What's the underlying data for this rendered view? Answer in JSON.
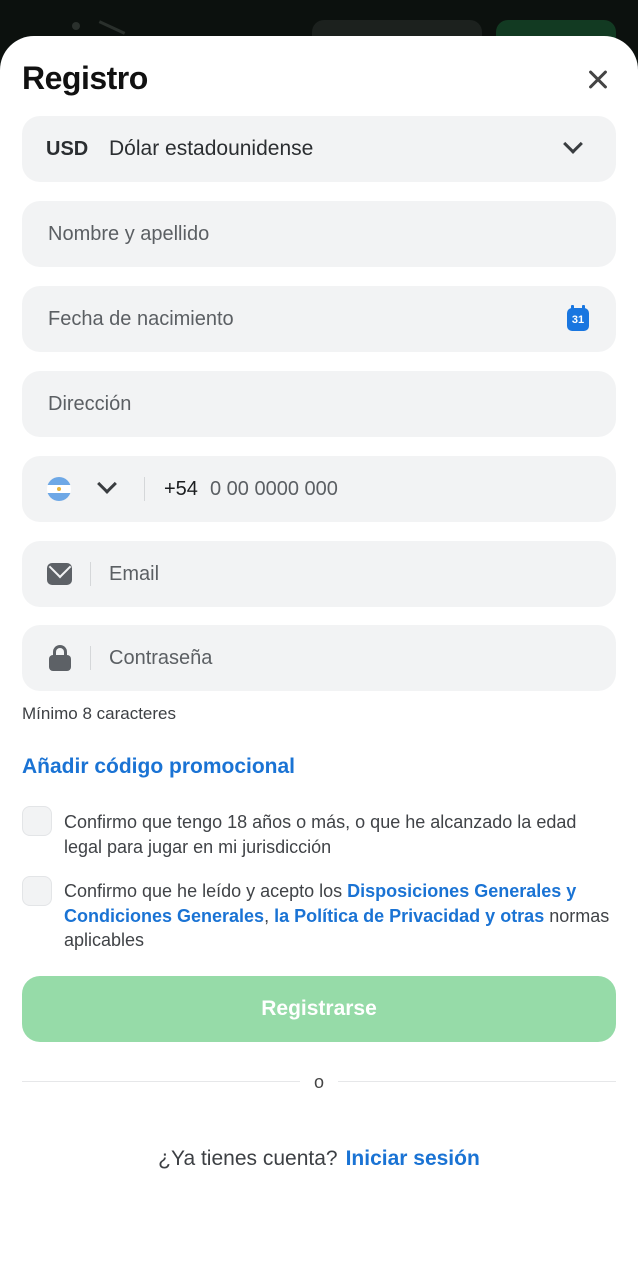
{
  "header": {
    "title": "Registro"
  },
  "currency": {
    "code": "USD",
    "name": "Dólar estadounidense"
  },
  "fields": {
    "full_name_placeholder": "Nombre y apellido",
    "birthdate_placeholder": "Fecha de nacimiento",
    "calendar_day": "31",
    "address_placeholder": "Dirección",
    "phone_prefix": "+54",
    "phone_placeholder": "0 00 0000 000",
    "email_placeholder": "Email",
    "password_placeholder": "Contraseña"
  },
  "password_hint": "Mínimo 8 caracteres",
  "promo_link": "Añadir código promocional",
  "consents": {
    "age_text": "Confirmo que tengo 18 años o más, o que he alcanzado la edad legal para jugar en mi jurisdicción",
    "terms_prefix": "Confirmo que he leído y acepto los ",
    "terms_link1": "Disposiciones Generales y Condiciones Generales",
    "terms_sep": ", ",
    "terms_link2": "la Política de Privacidad y otras",
    "terms_suffix": " normas aplicables"
  },
  "register_button": "Registrarse",
  "divider_text": "o",
  "login": {
    "prompt": "¿Ya tienes cuenta?",
    "link": "Iniciar sesión"
  },
  "colors": {
    "accent_link": "#1a73d4",
    "register_button_disabled": "#96dba8",
    "field_bg": "#f2f3f4"
  },
  "icons": [
    "close-icon",
    "chevron-down-icon",
    "calendar-icon",
    "argentina-flag-icon",
    "mail-icon",
    "lock-icon"
  ]
}
